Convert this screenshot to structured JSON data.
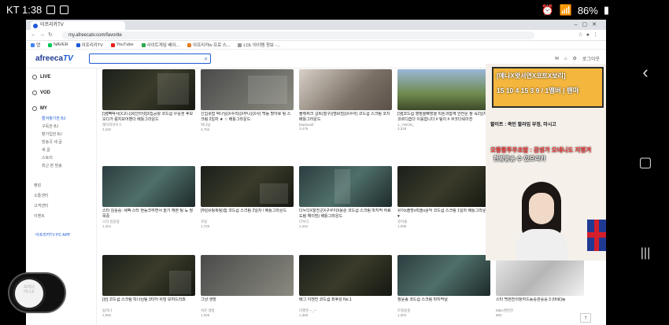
{
  "status": {
    "time": "KT 1:38",
    "battery": "86%"
  },
  "browser": {
    "tab_title": "아프리카TV",
    "url": "my.afreecatv.com/favorite",
    "bookmarks": [
      "앱",
      "NAVER",
      "아프리카TV",
      "YouTube",
      "사이트게임 배이...",
      "아프리카tv 프로 스...",
      "LOL 아이템 정보 -..."
    ]
  },
  "site": {
    "logo_main": "afreeca",
    "logo_tv": "TV",
    "header_right": [
      "로그아웃"
    ]
  },
  "sidebar": {
    "sections": [
      {
        "label": "LIVE"
      },
      {
        "label": "VOD"
      },
      {
        "label": "MY"
      }
    ],
    "my_items": [
      "즐겨찾기한 BJ",
      "구독한 BJ",
      "팬가입한 BJ",
      "방송국 새 글",
      "새 글",
      "스토리",
      "최근 본 방송"
    ],
    "extra_items": [
      "랭킹",
      "소통센터",
      "고객센터",
      "이벤트"
    ],
    "app_label": "아프리카TV PC APP"
  },
  "cards": [
    {
      "title": "[냉]빽박사(X고니)X[인터넷]X집공활 코드컵 우승권 후보 오디가 럼치보어밴다 배틀그라운드",
      "bj": "레이지마우스",
      "views": "3,292"
    },
    {
      "title": "신입못맙 박나님(X수리)(X무니)(X사) 백동 할아로 팅 스크림 2일차 ★ ☆ 배틀그라운드",
      "bj": "박나님",
      "views": "4,784"
    },
    {
      "title": "블랙퀴크 걸트(철구)(엠브엄)(X수아) 코드컵 스크림 코치 배틀그라운드",
      "bj": "blackwolf",
      "views": "3,475"
    },
    {
      "title": "[냉]코드컵 영정을빠장을 빅톤과함께 안전운 참 숙2일차 코르디습다 이를합니다 # 팀이 # 쿠크다워이전",
      "bj": "1_YWON_",
      "views": "3,328"
    },
    {
      "title": "스타 김윤중: 세팩 스타 현능크하면서 놀기 께본 팅 뇨 정목중",
      "bj": "스타 김윤중",
      "views": "1,451"
    },
    {
      "title": "[두](유팅톡팅)칩 코드컵 스크림 2일차 / 배틀그라운드",
      "bj": "유팅",
      "views": "1,725"
    },
    {
      "title": "다누다X잘진곤X구루이X용순 코드컵 스크림 마지막 하료도림 해이빙) 배틀그라운드",
      "bj": "다누다",
      "views": "1,291"
    },
    {
      "title": "유이x솔방x럭솔x윤딕 코드컵 스크림 1일차 배틀그라운드♥",
      "bj": "유이솔",
      "views": "1,095"
    },
    {
      "title": "[원] 코드컵 스크림 빅나님팀 3티어 위엄 보여드리죠",
      "bj": "팀이나",
      "views": "1,062"
    },
    {
      "title": "그냥 생방",
      "bj": "서문 생방",
      "views": "1,025"
    },
    {
      "title": "배그 이젠진 코드컵 최후성 No.1",
      "bj": "이젠진 ~_~",
      "views": "1,350"
    },
    {
      "title": "정윤종 코드컵 스크림 마지막날",
      "bj": "트정윤종",
      "views": "1,004"
    },
    {
      "title": "스타 백현전의창자드동승관중중 3 (바로)동",
      "bj": "MBA랜현전",
      "views": "883"
    }
  ],
  "stream": {
    "banner_line1": "[예나X왓서연X코트X보리]",
    "banner_line2": "15 10 4 15 3 9 / 1멤버 | 팬마",
    "caption1": "할이트 : 죽인 팔라임 부정, 마시고",
    "caption2": "오뚱뚱뚜우초밥 : 감성가 오네니도 지영겨",
    "caption3": "한방방송 수 있으리카"
  },
  "float_widget": {
    "line1": "오리너",
    "line2": "아니고"
  },
  "scroll_top": "↑"
}
